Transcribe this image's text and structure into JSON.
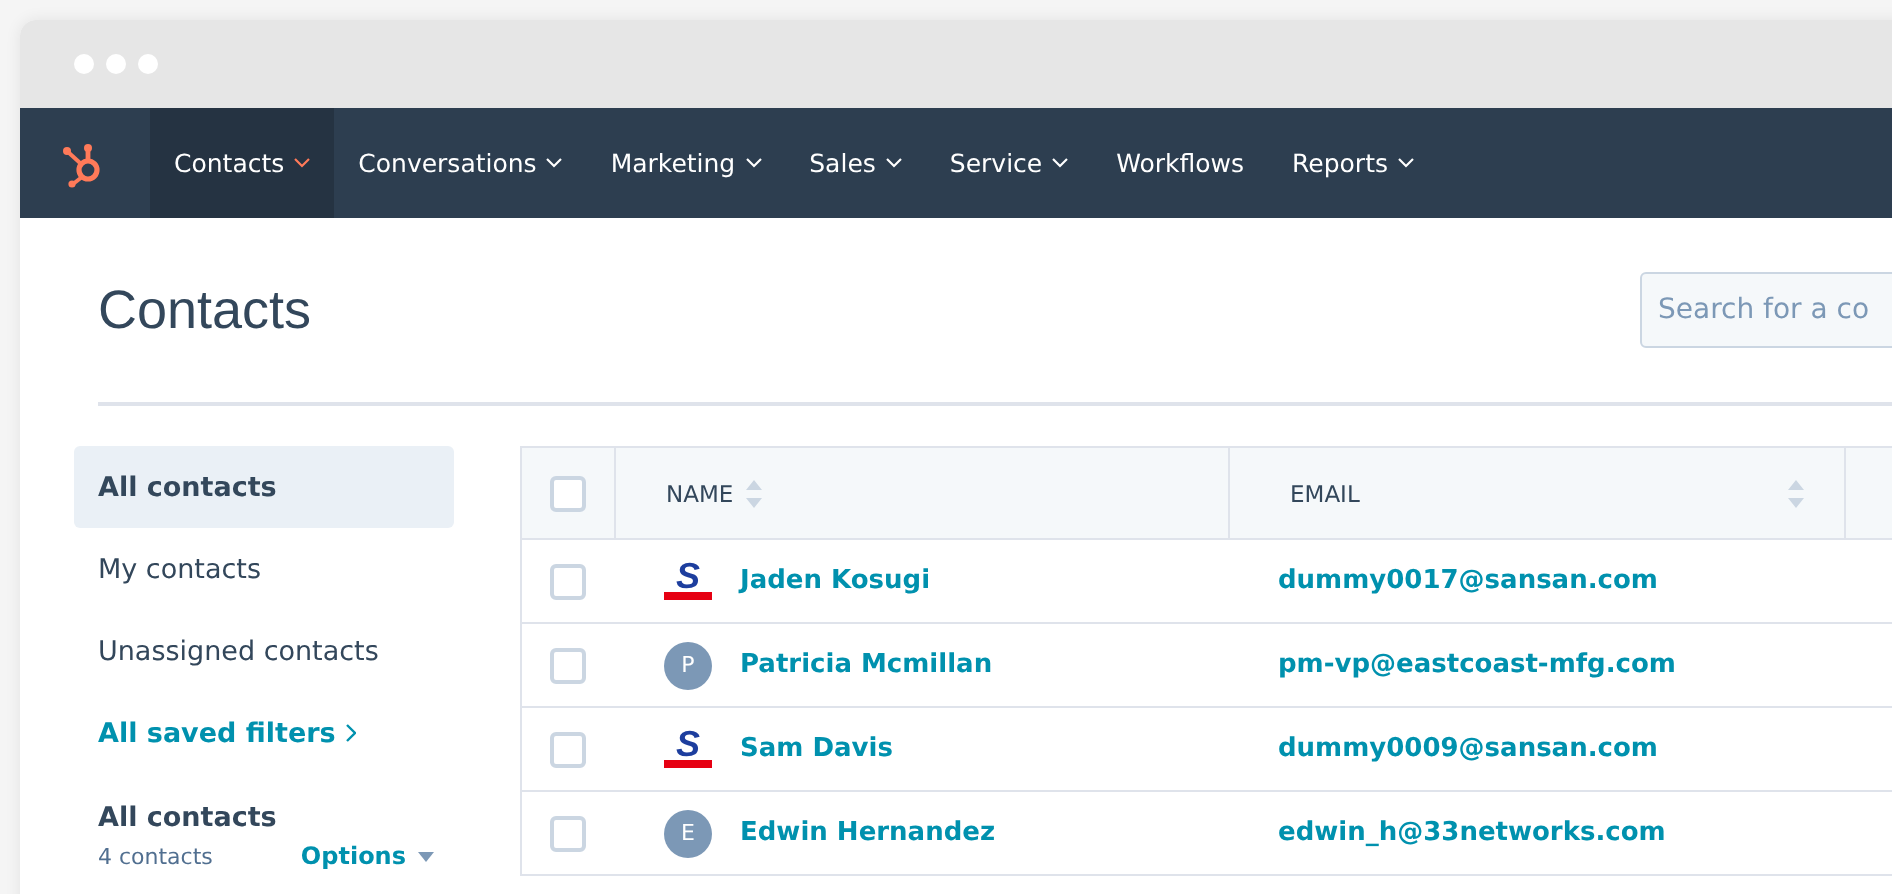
{
  "nav": {
    "items": [
      {
        "label": "Contacts",
        "selected": true,
        "dropdown": true
      },
      {
        "label": "Conversations",
        "selected": false,
        "dropdown": true
      },
      {
        "label": "Marketing",
        "selected": false,
        "dropdown": true
      },
      {
        "label": "Sales",
        "selected": false,
        "dropdown": true
      },
      {
        "label": "Service",
        "selected": false,
        "dropdown": true
      },
      {
        "label": "Workflows",
        "selected": false,
        "dropdown": false
      },
      {
        "label": "Reports",
        "selected": false,
        "dropdown": true
      }
    ]
  },
  "page": {
    "title": "Contacts",
    "search": {
      "placeholder": "Search for a co"
    }
  },
  "sidebar": {
    "items": [
      {
        "label": "All contacts",
        "selected": true
      },
      {
        "label": "My contacts",
        "selected": false
      },
      {
        "label": "Unassigned contacts",
        "selected": false
      }
    ],
    "saved_filters_link": "All saved filters",
    "current_view": {
      "title": "All contacts",
      "count": "4 contacts",
      "options": "Options"
    }
  },
  "table": {
    "select_all_checked": false,
    "columns": [
      "NAME",
      "EMAIL"
    ],
    "rows": [
      {
        "checked": false,
        "avatar": {
          "kind": "logo",
          "text": "S"
        },
        "name": "Jaden Kosugi",
        "email": "dummy0017@sansan.com"
      },
      {
        "checked": false,
        "avatar": {
          "kind": "initial",
          "text": "P"
        },
        "name": "Patricia Mcmillan",
        "email": "pm-vp@eastcoast-mfg.com"
      },
      {
        "checked": false,
        "avatar": {
          "kind": "logo",
          "text": "S"
        },
        "name": "Sam Davis",
        "email": "dummy0009@sansan.com"
      },
      {
        "checked": false,
        "avatar": {
          "kind": "initial",
          "text": "E"
        },
        "name": "Edwin Hernandez",
        "email": "edwin_h@33networks.com"
      }
    ]
  }
}
